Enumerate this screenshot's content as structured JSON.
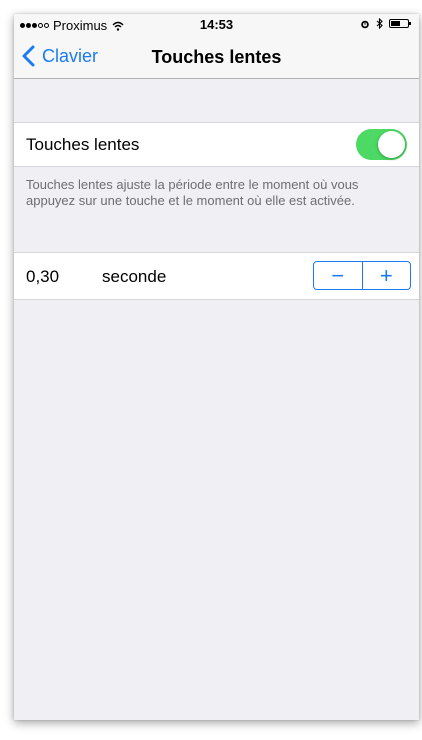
{
  "status_bar": {
    "carrier": "Proximus",
    "time": "14:53",
    "signal_dots_filled": 3,
    "signal_dots_total": 5,
    "icons": [
      "wifi-icon",
      "alarm-icon",
      "bluetooth-icon",
      "battery-icon"
    ],
    "battery_level": 0.55
  },
  "nav": {
    "back_label": "Clavier",
    "title": "Touches lentes"
  },
  "toggle_row": {
    "label": "Touches lentes",
    "enabled": true
  },
  "footer": {
    "text": "Touches lentes ajuste la période entre le moment où vous appuyez sur une touche et le moment où elle est activée."
  },
  "stepper_row": {
    "value": "0,30",
    "unit": "seconde",
    "minus_label": "−",
    "plus_label": "+"
  },
  "colors": {
    "accent": "#1b7cf2",
    "switch_on": "#4cd964",
    "background": "#efeff4",
    "footer_text": "#6d6d72"
  }
}
